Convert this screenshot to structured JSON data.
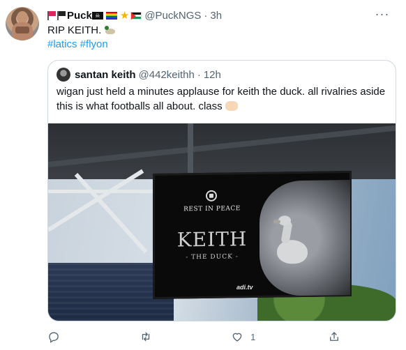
{
  "tweet": {
    "display_name": "Puck",
    "handle": "@PuckNGS",
    "separator": "·",
    "time": "3h",
    "text": "RIP KEITH.",
    "hashtags": "#latics #flyon",
    "more_label": "···",
    "badge_icons": [
      "red-flag-icon",
      "black-flag-icon",
      "pirate-flag-icon",
      "rainbow-flag-icon",
      "star-icon",
      "palestine-flag-icon"
    ]
  },
  "quote": {
    "display_name": "santan keith",
    "handle": "@442keithh",
    "separator": "·",
    "time": "12h",
    "text": "wigan just held a minutes applause for keith the duck. all rivalries aside this is what footballs all about. class",
    "image": {
      "screen_line1": "REST IN PEACE",
      "screen_line2": "KEITH",
      "screen_line3": "- THE DUCK -",
      "board_brand": "adi.tv"
    }
  },
  "actions": {
    "reply_count": "",
    "retweet_count": "",
    "like_count": "1",
    "share_count": ""
  },
  "colors": {
    "link": "#1d9bf0",
    "muted": "#536471",
    "border": "#cfd9de"
  }
}
